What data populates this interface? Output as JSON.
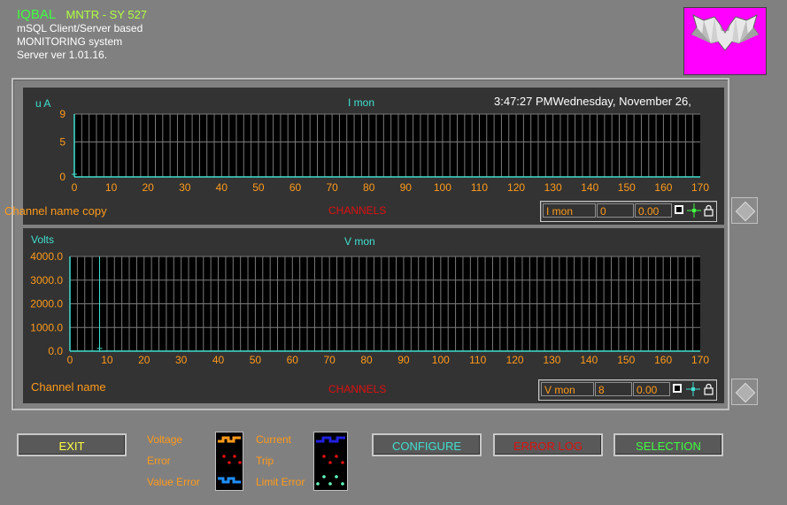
{
  "header": {
    "app_name": "IQBAL",
    "app_code": "MNTR - SY 527",
    "line1": "mSQL Client/Server  based",
    "line2": "MONITORING  system",
    "line3": "Server ver 1.01.16."
  },
  "panels": [
    {
      "ylabel": "u A",
      "title": "I mon",
      "datetime": "3:47:27 PMWednesday, November 26,",
      "xlabel": "CHANNELS",
      "channel_label": "Channel name copy",
      "control": {
        "param": "I mon",
        "channel": "0",
        "value": "0.00"
      }
    },
    {
      "ylabel": "Volts",
      "title": "V mon",
      "xlabel": "CHANNELS",
      "channel_label": "Channel name",
      "control": {
        "param": "V mon",
        "channel": "8",
        "value": "0.00"
      }
    }
  ],
  "chart_data": [
    {
      "type": "bar",
      "title": "I mon",
      "ylabel": "u A",
      "xlabel": "CHANNELS",
      "xlim": [
        0,
        170
      ],
      "ylim": [
        0,
        9
      ],
      "yticks": [
        "0",
        "5",
        "9"
      ],
      "xticks": [
        0,
        10,
        20,
        30,
        40,
        50,
        60,
        70,
        80,
        90,
        100,
        110,
        120,
        130,
        140,
        150,
        160,
        170
      ],
      "cursor_channel": 0,
      "values": [],
      "grid": true,
      "colors": {
        "grid": "#7a7a7a",
        "axis": "#40e0d0",
        "tick_labels": "#ff9a1a"
      }
    },
    {
      "type": "bar",
      "title": "V mon",
      "ylabel": "Volts",
      "xlabel": "CHANNELS",
      "xlim": [
        0,
        170
      ],
      "ylim": [
        0,
        4000
      ],
      "yticks": [
        "0.0",
        "1000.0",
        "2000.0",
        "3000.0",
        "4000.0"
      ],
      "xticks": [
        0,
        10,
        20,
        30,
        40,
        50,
        60,
        70,
        80,
        90,
        100,
        110,
        120,
        130,
        140,
        150,
        160,
        170
      ],
      "cursor_channel": 8,
      "values": [],
      "grid": true,
      "colors": {
        "grid": "#7a7a7a",
        "axis": "#40e0d0",
        "tick_labels": "#ff9a1a"
      }
    }
  ],
  "buttons": {
    "exit": "EXIT",
    "configure": "CONFIGURE",
    "error_log": "ERROR LOG",
    "selection": "SELECTION"
  },
  "legend": {
    "voltage": "Voltage",
    "error": "Error",
    "value_error": "Value Error",
    "current": "Current",
    "trip": "Trip",
    "limit_error": "Limit Error"
  },
  "colors": {
    "orange": "#ff9a1a",
    "cyan": "#40e0d0",
    "red": "#e01010",
    "green": "#40ff40",
    "logo_bg": "#ff00ff"
  }
}
